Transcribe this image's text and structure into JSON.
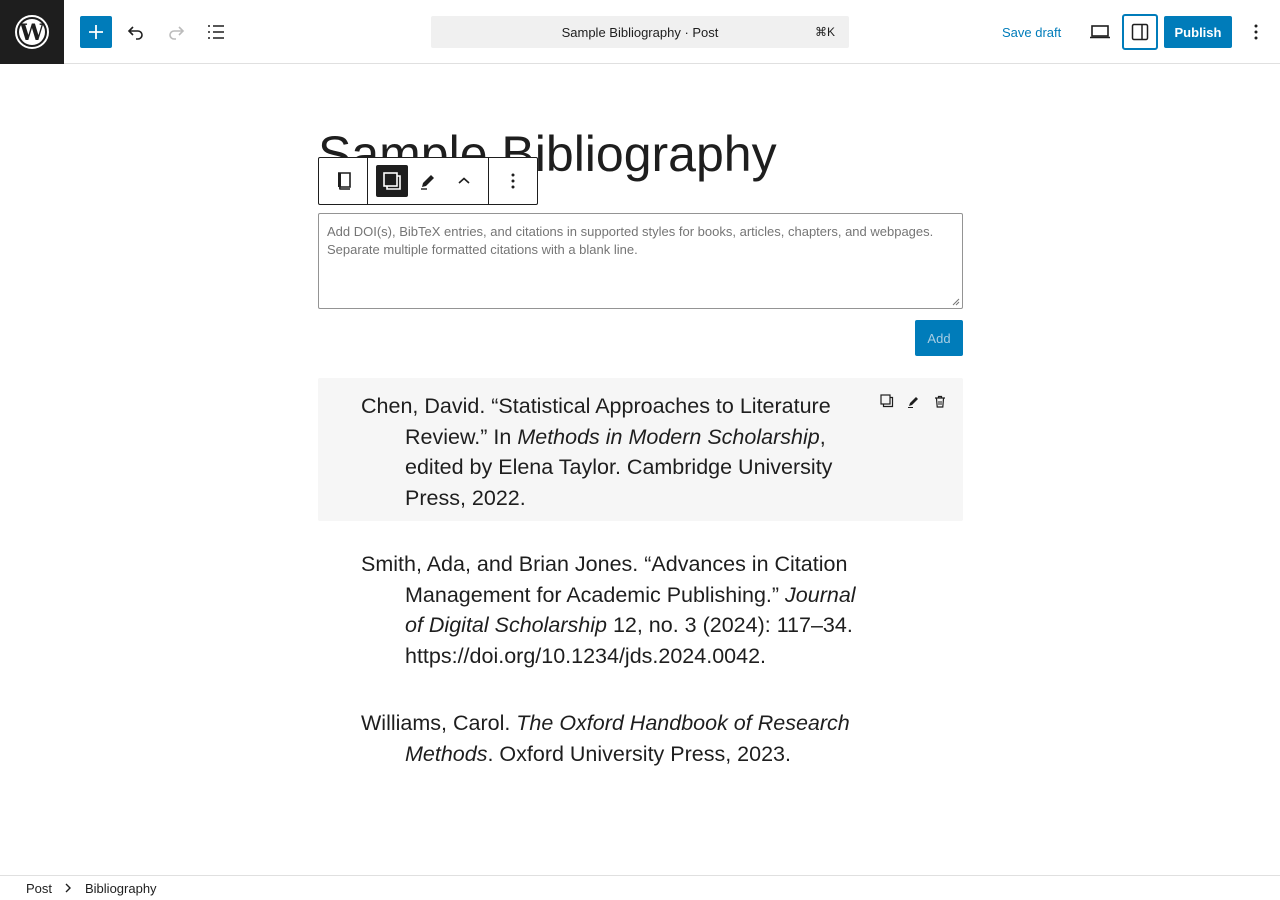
{
  "header": {
    "logo_icon": "wordpress-logo-icon",
    "command_bar": {
      "title": "Sample Bibliography · Post",
      "shortcut": "⌘K"
    },
    "save_draft_label": "Save draft",
    "publish_label": "Publish",
    "accent_color": "#007cba"
  },
  "post": {
    "title": "Sample Bibliography"
  },
  "block_toolbar": {
    "icons": [
      "bibliography-block-icon",
      "copy-icon",
      "edit-pencil-icon",
      "chevron-up-icon",
      "options-vertical-icon"
    ]
  },
  "citation_input": {
    "placeholder": "Add DOI(s), BibTeX entries, and citations in supported styles for books, articles, chapters, and webpages. Separate multiple formatted citations with a blank line.",
    "add_label": "Add"
  },
  "entries": [
    {
      "lead": "Chen, David. “Statistical Approaches to Literature Review.” In ",
      "italic": "Methods in Modern Scholarship",
      "tail": ", edited by Elena Taylor. Cambridge University Press, 2022."
    },
    {
      "lead": "Smith, Ada, and Brian Jones. “Advances in Citation Management for Academic Publishing.” ",
      "italic": "Journal of Digital Scholarship",
      "tail": " 12, no. 3 (2024): 117–34. https://doi.org/10.1234/jds.2024.0042."
    },
    {
      "lead": "Williams, Carol. ",
      "italic": "The Oxford Handbook of Research Methods",
      "tail": ". Oxford University Press, 2023."
    }
  ],
  "breadcrumb": {
    "items": [
      "Post",
      "Bibliography"
    ]
  }
}
